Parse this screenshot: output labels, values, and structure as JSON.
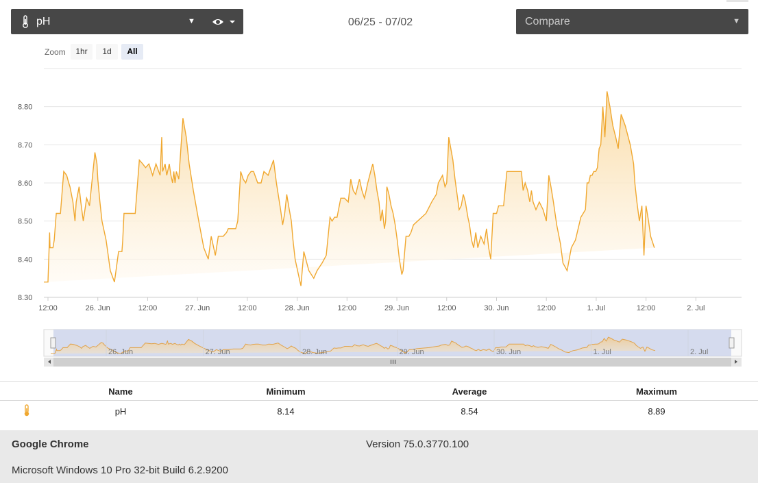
{
  "toolbar": {
    "metric_label": "pH",
    "metric_icon": "thermometer-icon",
    "view_icon": "eye-icon",
    "date_range": "06/25 - 07/02",
    "compare_placeholder": "Compare"
  },
  "zoom": {
    "label": "Zoom",
    "buttons": [
      "1hr",
      "1d",
      "All"
    ],
    "active": "All"
  },
  "colors": {
    "series_line": "#f0a830",
    "series_fill_top": "#f9d9a0",
    "navigator_mask": "#c8d0ea",
    "toolbar_bg": "#474747"
  },
  "chart_data": {
    "type": "area",
    "y_ticks": [
      "8.30",
      "8.40",
      "8.50",
      "8.60",
      "8.70",
      "8.80"
    ],
    "ylim": [
      8.3,
      8.9
    ],
    "x_ticks": [
      "12:00",
      "26. Jun",
      "12:00",
      "27. Jun",
      "12:00",
      "28. Jun",
      "12:00",
      "29. Jun",
      "12:00",
      "30. Jun",
      "12:00",
      "1. Jul",
      "12:00",
      "2. Jul"
    ],
    "x_hours": [
      0,
      12,
      24,
      36,
      48,
      60,
      72,
      84,
      96,
      108,
      120,
      132,
      144,
      156
    ],
    "navigator_ticks": [
      "26. Jun",
      "27. Jun",
      "28. Jun",
      "29. Jun",
      "30. Jun",
      "1. Jul",
      "2. Jul"
    ],
    "grid": true,
    "series": [
      {
        "hours": [
          -1.0,
          0.0,
          0.4,
          0.5,
          1.2,
          1.5,
          2.0,
          3.0,
          3.8,
          4.5,
          5.0,
          5.3,
          6.0,
          6.5,
          6.8,
          7.5,
          7.9,
          8.5,
          9.3,
          10.0,
          11.3,
          11.8,
          12.0,
          12.5,
          13.0,
          14.0,
          14.5,
          15.0,
          16.0,
          17.0,
          17.8,
          18.0,
          18.3,
          19.0,
          19.8,
          20.5,
          21.0,
          21.5,
          22.0,
          22.8,
          23.5,
          24.3,
          25.2,
          26.0,
          27.0,
          27.4,
          27.6,
          28.2,
          28.6,
          29.2,
          29.6,
          30.0,
          30.3,
          30.6,
          30.9,
          31.5,
          32.5,
          33.3,
          34.0,
          35.0,
          36.3,
          37.5,
          38.6,
          39.3,
          39.9,
          40.3,
          41.0,
          42.2,
          43.0,
          43.4,
          44.5,
          45.2,
          45.7,
          46.4,
          47.0,
          47.6,
          48.2,
          48.9,
          49.5,
          50.5,
          51.3,
          52.0,
          53.0,
          54.3,
          55.0,
          56.0,
          56.5,
          57.0,
          57.5,
          58.1,
          58.6,
          59.0,
          59.5,
          60.3,
          60.9,
          61.6,
          62.8,
          64.0,
          64.8,
          66.0,
          67.0,
          67.9,
          68.4,
          69.0,
          69.6,
          70.5,
          71.4,
          72.3,
          72.9,
          73.5,
          74.1,
          75.0,
          75.6,
          76.2,
          77.0,
          77.7,
          78.2,
          78.7,
          79.2,
          79.7,
          80.1,
          80.5,
          81.0,
          81.3,
          81.6,
          82.1,
          82.6,
          83.1,
          83.6,
          84.1,
          84.6,
          85.2,
          85.5,
          86.2,
          86.9,
          87.4,
          88.0,
          89.0,
          90.0,
          91.0,
          92.4,
          93.5,
          94.0,
          95.0,
          95.6,
          96.0,
          96.5,
          97.0,
          97.5,
          98.0,
          98.5,
          99.0,
          99.5,
          100.0,
          100.5,
          101.1,
          101.5,
          102.0,
          102.5,
          103.0,
          103.5,
          104.2,
          105.0,
          105.6,
          106.1,
          106.6,
          107.2,
          107.7,
          108.0,
          108.5,
          109.1,
          109.7,
          110.5,
          111.0,
          111.6,
          112.4,
          113.5,
          114.0,
          114.4,
          114.9,
          115.5,
          116.0,
          116.4,
          116.8,
          117.5,
          118.3,
          119.2,
          120.0,
          120.6,
          121.1,
          121.7,
          122.5,
          123.4,
          124.0,
          125.0,
          126.0,
          127.0,
          128.3,
          129.4,
          129.8,
          130.2,
          130.6,
          131.0,
          131.4,
          131.9,
          132.3,
          132.7,
          133.1,
          133.6,
          134.1,
          134.6,
          135.3,
          136.0,
          136.7,
          137.3,
          138.0,
          139.0,
          140.2,
          141.0,
          141.3,
          141.8,
          142.4,
          143.0,
          143.5,
          144.0,
          144.6,
          145.1,
          146.0,
          147.0,
          148.0,
          149.0,
          149.6,
          150.1,
          150.6,
          151.0,
          151.4,
          151.7,
          152.0,
          152.5,
          153.0,
          153.6,
          154.0,
          154.5,
          155.2,
          155.7,
          156.3,
          157.0,
          157.5,
          158.3,
          159.0,
          159.8,
          160.2,
          160.7,
          161.1,
          161.7,
          162.1,
          162.5,
          162.9,
          163.2,
          163.4
        ],
        "values": [
          8.34,
          8.34,
          8.47,
          8.43,
          8.43,
          8.45,
          8.52,
          8.52,
          8.63,
          8.62,
          8.6,
          8.59,
          8.55,
          8.5,
          8.55,
          8.59,
          8.55,
          8.5,
          8.56,
          8.54,
          8.68,
          8.65,
          8.61,
          8.55,
          8.5,
          8.45,
          8.41,
          8.37,
          8.34,
          8.42,
          8.42,
          8.45,
          8.52,
          8.52,
          8.52,
          8.52,
          8.52,
          8.59,
          8.66,
          8.65,
          8.64,
          8.65,
          8.62,
          8.65,
          8.62,
          8.72,
          8.63,
          8.65,
          8.62,
          8.65,
          8.62,
          8.6,
          8.63,
          8.6,
          8.63,
          8.61,
          8.77,
          8.72,
          8.65,
          8.58,
          8.5,
          8.43,
          8.4,
          8.46,
          8.43,
          8.41,
          8.46,
          8.46,
          8.47,
          8.48,
          8.48,
          8.48,
          8.5,
          8.63,
          8.61,
          8.6,
          8.62,
          8.63,
          8.63,
          8.6,
          8.6,
          8.63,
          8.62,
          8.66,
          8.6,
          8.53,
          8.49,
          8.52,
          8.57,
          8.53,
          8.5,
          8.45,
          8.4,
          8.36,
          8.33,
          8.42,
          8.37,
          8.35,
          8.37,
          8.39,
          8.41,
          8.51,
          8.5,
          8.51,
          8.51,
          8.56,
          8.56,
          8.55,
          8.61,
          8.58,
          8.57,
          8.61,
          8.58,
          8.56,
          8.6,
          8.63,
          8.65,
          8.62,
          8.58,
          8.55,
          8.5,
          8.53,
          8.48,
          8.5,
          8.59,
          8.57,
          8.54,
          8.52,
          8.49,
          8.45,
          8.4,
          8.36,
          8.37,
          8.46,
          8.46,
          8.47,
          8.49,
          8.5,
          8.51,
          8.52,
          8.55,
          8.57,
          8.6,
          8.62,
          8.59,
          8.6,
          8.72,
          8.69,
          8.66,
          8.61,
          8.57,
          8.53,
          8.54,
          8.57,
          8.55,
          8.51,
          8.49,
          8.45,
          8.43,
          8.47,
          8.43,
          8.46,
          8.44,
          8.48,
          8.43,
          8.4,
          8.52,
          8.52,
          8.52,
          8.54,
          8.54,
          8.54,
          8.63,
          8.63,
          8.63,
          8.63,
          8.63,
          8.63,
          8.58,
          8.6,
          8.58,
          8.55,
          8.58,
          8.55,
          8.53,
          8.55,
          8.53,
          8.5,
          8.62,
          8.59,
          8.55,
          8.49,
          8.44,
          8.39,
          8.37,
          8.43,
          8.45,
          8.51,
          8.53,
          8.6,
          8.6,
          8.62,
          8.62,
          8.63,
          8.63,
          8.64,
          8.69,
          8.7,
          8.8,
          8.72,
          8.84,
          8.8,
          8.75,
          8.72,
          8.69,
          8.78,
          8.75,
          8.7,
          8.65,
          8.6,
          8.55,
          8.5,
          8.54,
          8.41,
          8.54,
          8.5,
          8.46,
          8.43
        ]
      }
    ]
  },
  "stats_table": {
    "headers": [
      "Name",
      "Minimum",
      "Average",
      "Maximum"
    ],
    "row": {
      "icon": "thermometer-icon",
      "name": "pH",
      "minimum": "8.14",
      "average": "8.54",
      "maximum": "8.89"
    }
  },
  "footer": {
    "browser": "Google Chrome",
    "version": "Version 75.0.3770.100",
    "os": "Microsoft Windows 10 Pro 32-bit Build 6.2.9200"
  }
}
